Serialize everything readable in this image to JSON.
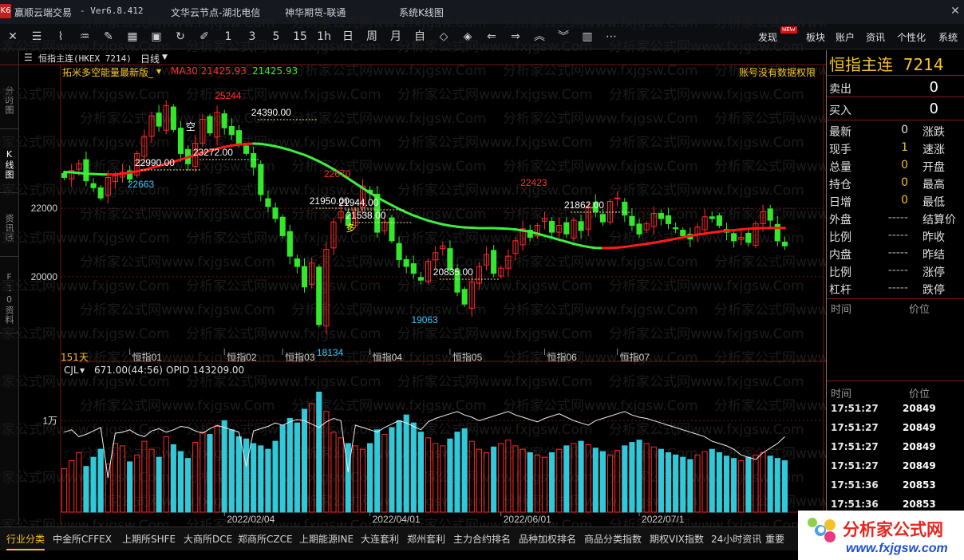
{
  "titlebar": {
    "app_icon": "K6",
    "app_name": "赢顺云端交易",
    "version": "- Ver6.8.412",
    "node": "文华云节点-湖北电信",
    "broker": "神华期货-联通",
    "title": "系统K线图"
  },
  "toolbar": {
    "periods": [
      "1",
      "3",
      "5",
      "15",
      "1h",
      "日",
      "周",
      "月"
    ],
    "menus": [
      "发现",
      "板块",
      "账户",
      "资讯",
      "个性化",
      "系统"
    ],
    "new_badge": "NEW"
  },
  "left_rail": [
    "分时图",
    "K线图",
    "资讯链",
    "F10资料"
  ],
  "chart_header": {
    "contract": "恒指主连(HKEX 7214)",
    "period": "日线",
    "indicator_name": "拓米多空能量最新版_",
    "ma_label": "MA30 21425.93",
    "ma_value": "21425.93",
    "no_permission": "账号没有数据权限",
    "days_label": "151天",
    "vol_indicator": "CJL",
    "vol_info": "671.00(44:56)",
    "opid_info": "OPID 143209.00"
  },
  "chart_data": {
    "type": "candlestick",
    "price_axis_ticks": [
      22000,
      20000
    ],
    "volume_axis_tick": "1万",
    "month_labels": [
      "恒指01",
      "恒指02",
      "恒指03",
      "恒指04",
      "恒指05",
      "恒指06",
      "恒指07"
    ],
    "date_labels": [
      "2022/02/04",
      "2022/04/01",
      "2022/06/01",
      "2022/07/1"
    ],
    "annotations": [
      {
        "text": "25244",
        "color": "#ff3030"
      },
      {
        "text": "22663",
        "color": "#38c8ff"
      },
      {
        "text": "22670",
        "color": "#ff3030"
      },
      {
        "text": "18134",
        "color": "#38c8ff"
      },
      {
        "text": "19063",
        "color": "#38c8ff"
      },
      {
        "text": "22423",
        "color": "#ff3030"
      },
      {
        "text": "24390.00",
        "color": "#ffffff"
      },
      {
        "text": "23272.00",
        "color": "#ffffff"
      },
      {
        "text": "22990.00",
        "color": "#ffffff"
      },
      {
        "text": "21950.00",
        "color": "#ffffff"
      },
      {
        "text": "21944.00",
        "color": "#ffffff"
      },
      {
        "text": "21538.00",
        "color": "#ffffff"
      },
      {
        "text": "20835.00",
        "color": "#ffffff"
      },
      {
        "text": "21862.00",
        "color": "#ffffff"
      },
      {
        "text": "空",
        "color": "#ffffff"
      },
      {
        "text": "多",
        "color": "#ffff00"
      }
    ],
    "ma30": [
      23060,
      23050,
      23030,
      23010,
      23000,
      22990,
      22985,
      22990,
      23010,
      23040,
      23080,
      23120,
      23180,
      23240,
      23300,
      23360,
      23420,
      23490,
      23560,
      23620,
      23680,
      23740,
      23790,
      23830,
      23860,
      23880,
      23890,
      23880,
      23850,
      23810,
      23760,
      23700,
      23630,
      23560,
      23470,
      23370,
      23260,
      23140,
      23010,
      22870,
      22730,
      22590,
      22450,
      22320,
      22200,
      22090,
      21980,
      21880,
      21790,
      21710,
      21640,
      21580,
      21530,
      21490,
      21460,
      21440,
      21430,
      21420,
      21420,
      21420,
      21410,
      21400,
      21380,
      21350,
      21310,
      21260,
      21200,
      21140,
      21080,
      21020,
      20960,
      20910,
      20870,
      20840,
      20835,
      20840,
      20850,
      20870,
      20900,
      20930,
      20960,
      20990,
      21030,
      21070,
      21110,
      21150,
      21190,
      21230,
      21260,
      21290,
      21320,
      21340,
      21360,
      21380,
      21400,
      21410,
      21420,
      21425,
      21426,
      21425
    ],
    "closes": [
      22900,
      23100,
      23300,
      22800,
      22600,
      22300,
      22900,
      22950,
      23050,
      22850,
      23600,
      24100,
      24700,
      24400,
      25000,
      24300,
      23600,
      23300,
      23900,
      24600,
      24200,
      24800,
      24350,
      24150,
      23900,
      23600,
      23200,
      22400,
      22050,
      21700,
      21200,
      20600,
      20300,
      19700,
      20400,
      18600,
      20800,
      21600,
      21900,
      21500,
      21950,
      22650,
      22450,
      21300,
      21600,
      21050,
      20500,
      20300,
      20100,
      19900,
      20450,
      20700,
      20900,
      20200,
      19550,
      19200,
      19850,
      20300,
      20650,
      20100,
      20250,
      20600,
      21050,
      21400,
      21150,
      21500,
      21700,
      21300,
      21500,
      21250,
      21650,
      21350,
      22050,
      21900,
      21600,
      22200,
      22300,
      21800,
      21500,
      21250,
      21550,
      21850,
      21700,
      21550,
      21400,
      21200,
      21100,
      21450,
      21750,
      21700,
      21500,
      21300,
      21050,
      21150,
      21000,
      21550,
      21900,
      21650,
      21050,
      20900
    ],
    "volumes": [
      38,
      45,
      52,
      40,
      48,
      55,
      42,
      60,
      58,
      44,
      50,
      62,
      55,
      48,
      66,
      59,
      53,
      47,
      61,
      70,
      68,
      75,
      80,
      72,
      66,
      64,
      60,
      58,
      55,
      62,
      76,
      82,
      78,
      90,
      95,
      105,
      88,
      70,
      65,
      60,
      58,
      55,
      60,
      72,
      68,
      74,
      80,
      85,
      78,
      70,
      65,
      60,
      58,
      64,
      70,
      73,
      62,
      55,
      52,
      57,
      60,
      63,
      58,
      55,
      52,
      50,
      48,
      52,
      55,
      58,
      60,
      62,
      59,
      56,
      53,
      50,
      54,
      58,
      61,
      63,
      60,
      57,
      55,
      52,
      50,
      48,
      46,
      50,
      53,
      55,
      52,
      49,
      47,
      45,
      48,
      50,
      52,
      49,
      47,
      45
    ],
    "opid_line": [
      70,
      72,
      66,
      68,
      71,
      74,
      30,
      69,
      70,
      72,
      68,
      66,
      71,
      73,
      70,
      72,
      75,
      74,
      71,
      69,
      73,
      76,
      74,
      72,
      70,
      40,
      71,
      73,
      75,
      78,
      76,
      79,
      81,
      80,
      77,
      74,
      79,
      82,
      80,
      35,
      76,
      74,
      72,
      70,
      74,
      77,
      80,
      78,
      75,
      72,
      79,
      82,
      84,
      86,
      88,
      85,
      83,
      80,
      82,
      84,
      86,
      88,
      85,
      83,
      81,
      79,
      82,
      84,
      86,
      83,
      80,
      78,
      76,
      80,
      82,
      84,
      86,
      88,
      85,
      83,
      82,
      80,
      78,
      76,
      74,
      72,
      70,
      68,
      66,
      62,
      60,
      58,
      55,
      50,
      48,
      46,
      52,
      56,
      60,
      66
    ]
  },
  "right_panel": {
    "title": "恒指主连",
    "code": "7214",
    "sell_label": "卖出",
    "sell_value": "0",
    "buy_label": "买入",
    "buy_value": "0",
    "rows": [
      {
        "l1": "最新",
        "v1": "0",
        "l2": "涨跌",
        "v2": ""
      },
      {
        "l1": "现手",
        "v1": "1",
        "l2": "速涨",
        "v2": ""
      },
      {
        "l1": "总量",
        "v1": "0",
        "l2": "开盘",
        "v2": ""
      },
      {
        "l1": "持仓",
        "v1": "0",
        "l2": "最高",
        "v2": ""
      },
      {
        "l1": "日增",
        "v1": "0",
        "l2": "最低",
        "v2": ""
      },
      {
        "l1": "外盘",
        "v1": "-----",
        "l2": "结算价",
        "v2": ""
      },
      {
        "l1": "比例",
        "v1": "-----",
        "l2": "昨收",
        "v2": ""
      },
      {
        "l1": "内盘",
        "v1": "-----",
        "l2": "昨结",
        "v2": ""
      },
      {
        "l1": "比例",
        "v1": "-----",
        "l2": "涨停",
        "v2": ""
      },
      {
        "l1": "杠杆",
        "v1": "-----",
        "l2": "跌停",
        "v2": ""
      }
    ],
    "time_header": "时间",
    "price_header": "价位",
    "ticks": [
      {
        "time": "17:51:27",
        "price": "20849"
      },
      {
        "time": "17:51:27",
        "price": "20849"
      },
      {
        "time": "17:51:27",
        "price": "20849"
      },
      {
        "time": "17:51:27",
        "price": "20849"
      },
      {
        "time": "17:51:36",
        "price": "20853"
      },
      {
        "time": "17:51:36",
        "price": "20853"
      }
    ]
  },
  "bottom_tabs": [
    "行业分类",
    "中金所CFFEX",
    "上期所SHFE",
    "大商所DCE",
    "郑商所CZCE",
    "上期能源INE",
    "大连套利",
    "郑州套利",
    "主力合约排名",
    "品种加权排名",
    "商品分类指数",
    "期权VIX指数",
    "24小时资讯",
    "重要"
  ],
  "logo": {
    "name": "分析家公式网",
    "url": "www.fxjgsw.com"
  },
  "watermark": "分析家公式网www.fxjgsw.Com",
  "colors": {
    "up": "#ff2a2a",
    "down": "#33e82a",
    "ma_up": "#ff1a1a",
    "ma_down": "#3cf03c",
    "accent": "#f3c22c",
    "volume_down": "#32c8d8"
  }
}
